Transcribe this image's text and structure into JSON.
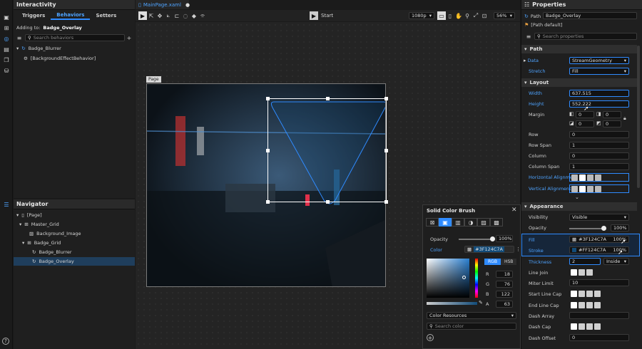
{
  "left_panel": {
    "title": "Interactivity",
    "tabs": [
      "Triggers",
      "Behaviors",
      "Setters"
    ],
    "adding_to_label": "Adding to:",
    "adding_to_value": "Badge_Overlay",
    "search_placeholder": "Search behaviors",
    "tree": [
      {
        "label": "Badge_Blurrer"
      },
      {
        "label": "[BackgroundEffectBehavior]"
      }
    ]
  },
  "navigator": {
    "title": "Navigator",
    "items": [
      {
        "label": "[Page]"
      },
      {
        "label": "Master_Grid"
      },
      {
        "label": "Background_Image"
      },
      {
        "label": "Badge_Grid"
      },
      {
        "label": "Badge_Blurrer"
      },
      {
        "label": "Badge_Overlay"
      }
    ]
  },
  "document": {
    "tab_label": "MainPage.xaml",
    "start_label": "Start",
    "resolution": "1080p",
    "zoom": "56%",
    "page_label": "Page"
  },
  "brush_popup": {
    "title": "Solid Color Brush",
    "opacity_label": "Opacity",
    "opacity_value": "100%",
    "opacity_fraction": 1.0,
    "color_label": "Color",
    "color_value": "#3F124C7A",
    "color_hex": "#124C7A",
    "modes": [
      "RGB",
      "HSB"
    ],
    "channels": [
      {
        "label": "R",
        "value": "18"
      },
      {
        "label": "G",
        "value": "76"
      },
      {
        "label": "B",
        "value": "122"
      },
      {
        "label": "A",
        "value": "63"
      }
    ],
    "resources_label": "Color Resources",
    "search_placeholder": "Search color"
  },
  "properties": {
    "title": "Properties",
    "path_label": "Path",
    "path_name": "Badge_Overlay",
    "path_default": "[Path default]",
    "search_placeholder": "Search properties",
    "path_section": {
      "title": "Path",
      "data_label": "Data",
      "data_value": "StreamGeometry",
      "stretch_label": "Stretch",
      "stretch_value": "Fill"
    },
    "layout_section": {
      "title": "Layout",
      "width_label": "Width",
      "width_value": "637.515",
      "height_label": "Height",
      "height_value": "552.222",
      "margin_label": "Margin",
      "margin_values": [
        "0",
        "0",
        "0",
        "0"
      ],
      "row_label": "Row",
      "row_value": "0",
      "row_span_label": "Row Span",
      "row_span_value": "1",
      "column_label": "Column",
      "column_value": "0",
      "column_span_label": "Column Span",
      "column_span_value": "1",
      "horizontal_label": "Horizontal Alignme...",
      "vertical_label": "Vertical Alignment"
    },
    "appearance_section": {
      "title": "Appearance",
      "visibility_label": "Visibility",
      "visibility_value": "Visible",
      "opacity_label": "Opacity",
      "opacity_value": "100%",
      "opacity_fraction": 1.0,
      "fill_label": "Fill",
      "fill_value": "#3F124C7A",
      "fill_pct": "100%",
      "stroke_label": "Stroke",
      "stroke_value": "#FF124C7A",
      "stroke_pct": "100%",
      "thickness_label": "Thickness",
      "thickness_value": "2",
      "thickness_mode": "Inside",
      "line_join_label": "Line Join",
      "miter_label": "Miter Limit",
      "miter_value": "10",
      "start_cap_label": "Start Line Cap",
      "end_cap_label": "End Line Cap",
      "dash_array_label": "Dash Array",
      "dash_cap_label": "Dash Cap",
      "dash_offset_label": "Dash Offset",
      "dash_offset_value": "0"
    }
  },
  "colors": {
    "accent": "#2f8bff",
    "panel_bg": "#1f1f1f",
    "canvas_bg": "#232323"
  }
}
